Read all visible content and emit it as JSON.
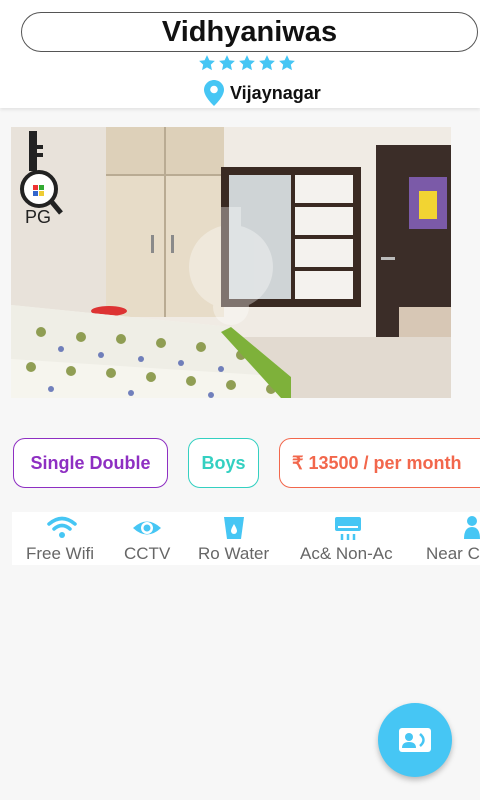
{
  "header": {
    "title": "Vidhyaniwas",
    "rating_stars": 5,
    "location": "Vijaynagar"
  },
  "photo": {
    "logo_text": "PG"
  },
  "chips": {
    "room_type": "Single Double",
    "gender": "Boys",
    "price": "₹ 13500 / per month"
  },
  "amenities": [
    {
      "label": "Free Wifi",
      "icon": "wifi-icon"
    },
    {
      "label": "CCTV",
      "icon": "eye-icon"
    },
    {
      "label": "Ro Water",
      "icon": "water-glass-icon"
    },
    {
      "label": "Ac& Non-Ac",
      "icon": "air-conditioner-icon"
    },
    {
      "label": "Near C",
      "icon": "person-icon"
    }
  ],
  "fab": {
    "icon": "contact-card-icon"
  },
  "colors": {
    "accent_blue": "#46c6f4",
    "room_purple": "#8e2fc2",
    "gender_teal": "#34d0c1",
    "price_orange": "#f2674c"
  }
}
